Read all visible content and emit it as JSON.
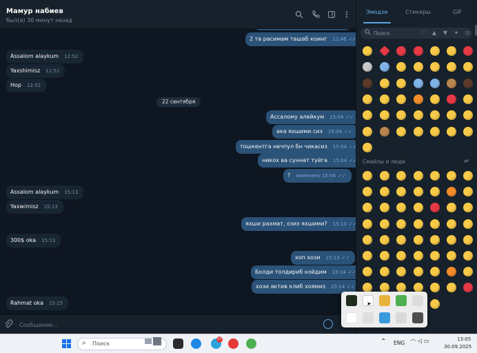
{
  "chat": {
    "name": "Мамур набиев",
    "status": "был(а) 30 минут назад",
    "date_divider": "22 сентября",
    "composer_placeholder": "Сообщение..."
  },
  "messages": [
    {
      "dir": "out",
      "text": "2 та расимам ташаб коинг",
      "time": "11:46"
    },
    {
      "dir": "in",
      "text": "Assalom alaykum",
      "time": "12:52"
    },
    {
      "dir": "in",
      "text": "Yaxshimisz",
      "time": "12:52"
    },
    {
      "dir": "in",
      "text": "Hop",
      "time": "12:52"
    },
    {
      "dir": "out",
      "text": "Ассалому алейкум",
      "time": "15:04"
    },
    {
      "dir": "out",
      "text": "ака яхшими сиз",
      "time": "15:04"
    },
    {
      "dir": "out",
      "text": "тошкентга нечпул бн чикасиз",
      "time": "15:04"
    },
    {
      "dir": "out",
      "text": "никох ва суннат туйга",
      "time": "15:04"
    },
    {
      "dir": "out",
      "text": "?",
      "time": "изменено 15:04"
    },
    {
      "dir": "in",
      "text": "Assalom alaykum",
      "time": "15:13"
    },
    {
      "dir": "in",
      "text": "Yaxwimisz",
      "time": "15:13"
    },
    {
      "dir": "out",
      "text": "яхши рахмат, озиз яхшими?",
      "time": "15:13"
    },
    {
      "dir": "in",
      "text": "300$ oka",
      "time": "15:13"
    },
    {
      "dir": "out",
      "text": "хоп хози",
      "time": "15:13"
    },
    {
      "dir": "out",
      "text": "Болди толдириб койдим",
      "time": "15:14"
    },
    {
      "dir": "out",
      "text": "хози актив клиб хоямиз",
      "time": "15:14"
    },
    {
      "dir": "in",
      "text": "Rahmat oka",
      "time": "15:15"
    }
  ],
  "emoji_panel": {
    "tabs": [
      "Эмодзи",
      "Стикеры",
      "GIF"
    ],
    "active_tab": "Эмодзи",
    "search_placeholder": "Поиск",
    "category_icons": [
      "heart-icon",
      "thumbs-up-icon",
      "thumbs-down-icon",
      "ribbon-icon",
      "clock-icon"
    ],
    "section_label": "Смайлы и люди"
  },
  "taskbar": {
    "search_placeholder": "Поиск",
    "language": "ENG",
    "time": "13:05",
    "date": "30.09.2025",
    "telegram_badge": "27"
  },
  "colors": {
    "chat_bg": "#0e1621",
    "panel_bg": "#17212b",
    "incoming_bubble": "#182533",
    "outgoing_bubble": "#2b5278",
    "accent": "#5aa7e6",
    "taskbar_bg": "#eef1f5"
  }
}
